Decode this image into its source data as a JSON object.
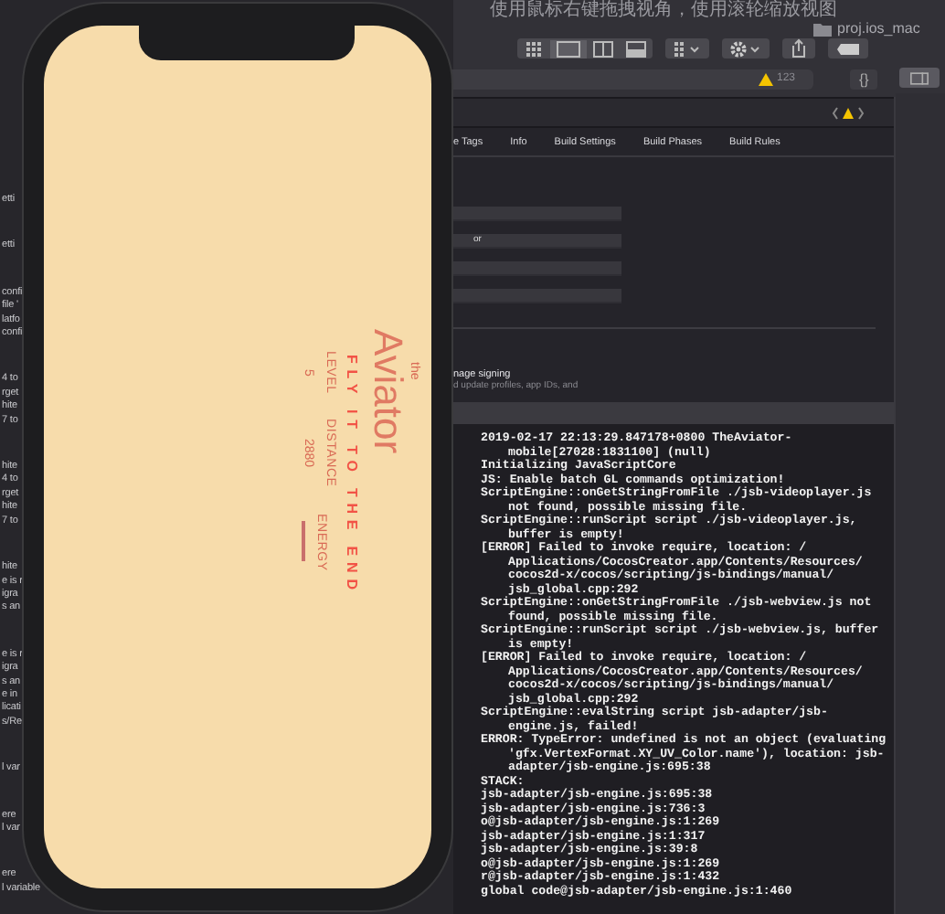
{
  "xcode": {
    "hint_text": "使用鼠标右键拖拽视角，使用滚轮缩放视图",
    "project": "proj.ios_mac",
    "warning_count": "123",
    "braces": "{}",
    "tabs": [
      {
        "label": "e Tags",
        "selected": false
      },
      {
        "label": "Info",
        "selected": false
      },
      {
        "label": "Build Settings",
        "selected": false
      },
      {
        "label": "Build Phases",
        "selected": false
      },
      {
        "label": "Build Rules",
        "selected": false
      }
    ],
    "fields": [
      {
        "kind": "empty"
      },
      {
        "kind": "text",
        "value": "or"
      },
      {
        "kind": "empty"
      },
      {
        "kind": "empty"
      }
    ],
    "left_fragment_groups": [
      [
        "etti"
      ],
      [
        "etti"
      ],
      [
        "confi",
        "file '",
        "latfo",
        "confi"
      ],
      [
        "4 to",
        "rget",
        "hite",
        "7 to"
      ],
      [
        "hite",
        "4 to",
        "rget",
        "hite",
        "7 to"
      ],
      [
        "hite",
        "e is r",
        "igra",
        "s an"
      ],
      [
        "e is r",
        "igra",
        "s an",
        "e in",
        "licati",
        "s/Re"
      ],
      [
        "l var"
      ],
      [
        "ere",
        "l var"
      ],
      [
        "ere",
        "l variable"
      ]
    ],
    "signing_title": "nage signing",
    "signing_desc": "d update profiles, app IDs, and",
    "console": [
      {
        "text": "2019-02-17 22:13:29.847178+0800 TheAviator-",
        "indent": false
      },
      {
        "text": "mobile[27028:1831100] (null)",
        "indent": true
      },
      {
        "text": "Initializing JavaScriptCore",
        "indent": false
      },
      {
        "text": "JS: Enable batch GL commands optimization!",
        "indent": false
      },
      {
        "text": "ScriptEngine::onGetStringFromFile ./jsb-videoplayer.js",
        "indent": false
      },
      {
        "text": "not found, possible missing file.",
        "indent": true
      },
      {
        "text": "ScriptEngine::runScript script ./jsb-videoplayer.js,",
        "indent": false
      },
      {
        "text": "buffer is empty!",
        "indent": true
      },
      {
        "text": "[ERROR] Failed to invoke require, location: /",
        "indent": false
      },
      {
        "text": "Applications/CocosCreator.app/Contents/Resources/",
        "indent": true
      },
      {
        "text": "cocos2d-x/cocos/scripting/js-bindings/manual/",
        "indent": true
      },
      {
        "text": "jsb_global.cpp:292",
        "indent": true
      },
      {
        "text": "ScriptEngine::onGetStringFromFile ./jsb-webview.js not",
        "indent": false
      },
      {
        "text": "found, possible missing file.",
        "indent": true
      },
      {
        "text": "ScriptEngine::runScript script ./jsb-webview.js, buffer",
        "indent": false
      },
      {
        "text": "is empty!",
        "indent": true
      },
      {
        "text": "[ERROR] Failed to invoke require, location: /",
        "indent": false
      },
      {
        "text": "Applications/CocosCreator.app/Contents/Resources/",
        "indent": true
      },
      {
        "text": "cocos2d-x/cocos/scripting/js-bindings/manual/",
        "indent": true
      },
      {
        "text": "jsb_global.cpp:292",
        "indent": true
      },
      {
        "text": "ScriptEngine::evalString script jsb-adapter/jsb-",
        "indent": false
      },
      {
        "text": "engine.js, failed!",
        "indent": true
      },
      {
        "text": "ERROR: TypeError: undefined is not an object (evaluating",
        "indent": false
      },
      {
        "text": "'gfx.VertexFormat.XY_UV_Color.name'), location: jsb-",
        "indent": true
      },
      {
        "text": "adapter/jsb-engine.js:695:38",
        "indent": true
      },
      {
        "text": "STACK:",
        "indent": false
      },
      {
        "text": "jsb-adapter/jsb-engine.js:695:38",
        "indent": false
      },
      {
        "text": "jsb-adapter/jsb-engine.js:736:3",
        "indent": false
      },
      {
        "text": "o@jsb-adapter/jsb-engine.js:1:269",
        "indent": false
      },
      {
        "text": "jsb-adapter/jsb-engine.js:1:317",
        "indent": false
      },
      {
        "text": "jsb-adapter/jsb-engine.js:39:8",
        "indent": false
      },
      {
        "text": "o@jsb-adapter/jsb-engine.js:1:269",
        "indent": false
      },
      {
        "text": "r@jsb-adapter/jsb-engine.js:1:432",
        "indent": false
      },
      {
        "text": "global code@jsb-adapter/jsb-engine.js:1:460",
        "indent": false
      }
    ]
  },
  "phone": {
    "game": {
      "the": "the",
      "title": "Aviator",
      "tagline": "FLY IT TO THE END",
      "stats": [
        {
          "kind": "value",
          "label": "LEVEL",
          "value": "5"
        },
        {
          "kind": "value",
          "label": "DISTANCE",
          "value": "2880"
        },
        {
          "kind": "bar",
          "label": "ENERGY",
          "level": 1
        }
      ]
    }
  }
}
